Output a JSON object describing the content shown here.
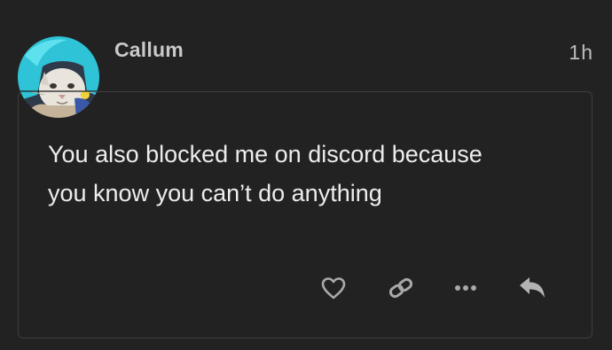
{
  "post": {
    "author": "Callum",
    "time": "1h",
    "body_lines": [
      "You also blocked me on discord because",
      "you know you can’t do anything"
    ]
  },
  "actions": [
    {
      "icon": "heart-icon",
      "label": "like"
    },
    {
      "icon": "link-icon",
      "label": "copy link"
    },
    {
      "icon": "more-icon",
      "label": "more"
    },
    {
      "icon": "reply-icon",
      "label": "reply"
    }
  ],
  "colors": {
    "background": "#222222",
    "border": "#3e3e3e",
    "text": "#ededed",
    "username": "#c9c9c9",
    "icons": "#a9a9a9",
    "avatar_accent": "#2ec3d6"
  }
}
